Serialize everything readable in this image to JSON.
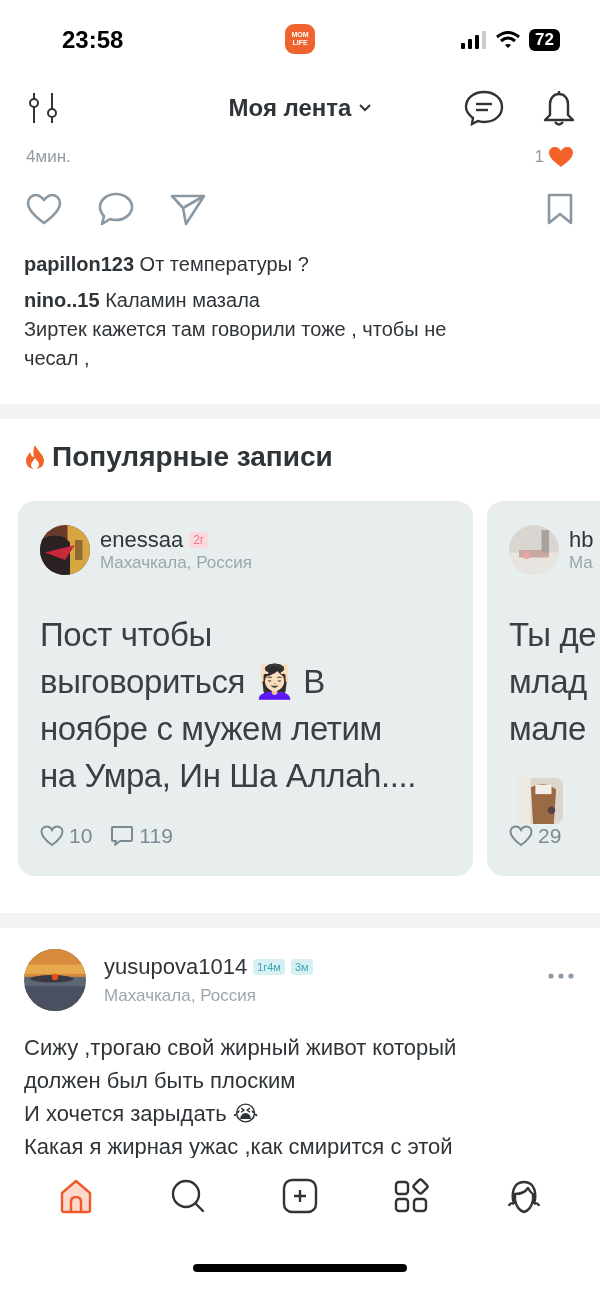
{
  "status_bar": {
    "time": "23:58",
    "app_logo": "MOM LIFE",
    "battery": "72"
  },
  "header": {
    "title": "Моя лента"
  },
  "post_tail": {
    "time": "4мин.",
    "like_count": "1",
    "liked": true
  },
  "comments": [
    {
      "author": "papillon123",
      "text": "От температуры ?"
    },
    {
      "author": "nino..15",
      "text": "Каламин мазала\nЗиртек кажется там говорили тоже , чтобы не\nчесал ,"
    }
  ],
  "popular": {
    "title": "Популярные записи",
    "cards": [
      {
        "author": "enessaa",
        "badge": "2г",
        "location": "Махачкала, Россия",
        "text": "Пост чтобы\nвыговориться 💆🏻‍♀️ В\nноябре с мужем летим\nна Умра, Ин Ша Аллаh....",
        "likes": "10",
        "comments": "119"
      },
      {
        "author": "hb",
        "location": "Ма",
        "text": "Ты де\nмлад\nмале",
        "likes": "29"
      }
    ]
  },
  "post": {
    "author": "yusupova1014",
    "badges": [
      "1г4м",
      "3м"
    ],
    "location": "Махачкала, Россия",
    "text": "Сижу ,трогаю свой жирный живот который\nдолжен был быть плоским\nИ хочется зарыдать 😭\nКакая я жирная ужас ,как смирится с этой"
  },
  "tab_bar": [
    {
      "selected": true
    },
    {
      "selected": false
    },
    {
      "selected": false
    },
    {
      "selected": false
    },
    {
      "selected": false
    }
  ]
}
